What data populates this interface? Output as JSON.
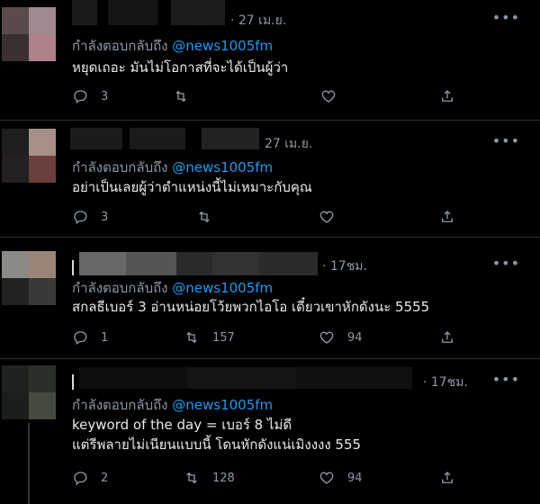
{
  "tweets": [
    {
      "time": "· 27 เม.ย.",
      "reply_prefix": "กำลังตอบกลับถึง",
      "handle": "@news1005fm",
      "text_lines": [
        "หยุดเถอะ มันไม่โอกาสที่จะได้เป็นผู้ว่า"
      ],
      "replies": "3",
      "retweets": "",
      "likes": ""
    },
    {
      "time": "27 เม.ย.",
      "reply_prefix": "กำลังตอบกลับถึง",
      "handle": "@news1005fm",
      "text_lines": [
        "อย่าเป็นเลยผู้ว่าตำแหน่งนี้ไม่เหมาะกับคุณ"
      ],
      "replies": "3",
      "retweets": "",
      "likes": ""
    },
    {
      "time": "· 17ชม.",
      "reply_prefix": "กำลังตอบกลับถึง",
      "handle": "@news1005fm",
      "text_lines": [
        "สกลธีเบอร์ 3 อ่านหน่อยโว้ยพวกไอโอ เดี๋ยวเขาหักดังนะ 5555"
      ],
      "replies": "1",
      "retweets": "157",
      "likes": "94"
    },
    {
      "time": "· 17ชม.",
      "reply_prefix": "กำลังตอบกลับถึง",
      "handle": "@news1005fm",
      "text_lines": [
        "keyword of the day = เบอร์ 8 ไม่ดี",
        "แต่รีพลายไม่เนียนแบบนี้ โดนหักดังแน่เมิงงงง 555"
      ],
      "replies": "2",
      "retweets": "128",
      "likes": "94"
    }
  ],
  "icons": {
    "more": "more-icon",
    "reply": "reply-icon",
    "retweet": "retweet-icon",
    "like": "like-icon",
    "share": "share-icon"
  },
  "colors": {
    "background": "#000000",
    "handle": "#1d9bf0",
    "muted": "#8b98a5",
    "text": "#e7e9ea"
  }
}
